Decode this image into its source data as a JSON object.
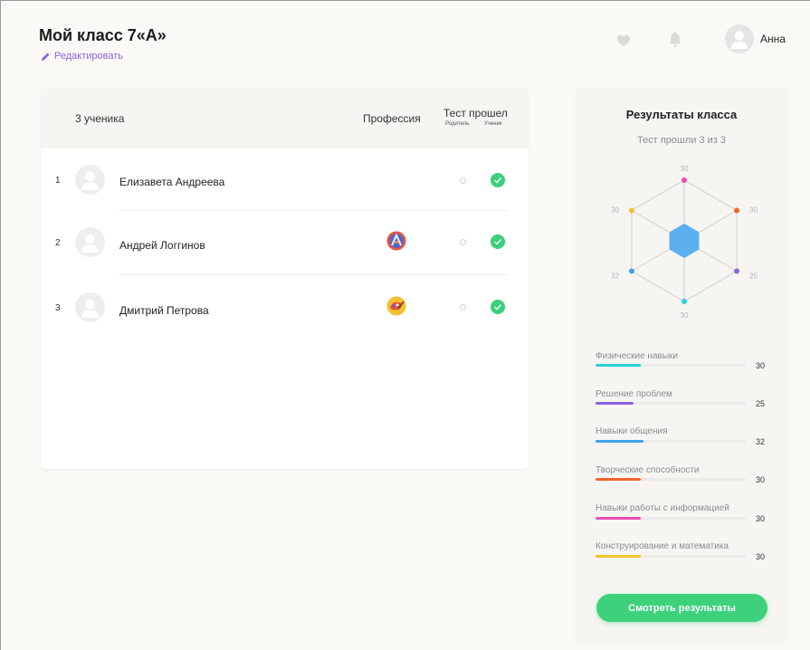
{
  "header": {
    "title": "Мой класс 7«А»",
    "edit_label": "Редактировать",
    "user_name": "Анна"
  },
  "students_table": {
    "count_label": "3 ученика",
    "profession_header": "Профессия",
    "test_header": "Тест прошел",
    "parent_sub": "Родитель",
    "student_sub": "Ученик",
    "rows": [
      {
        "num": "1",
        "name": "Елизавета Андреева",
        "profession": null,
        "parent_passed": false,
        "student_passed": true
      },
      {
        "num": "2",
        "name": "Андрей Логгинов",
        "profession": "architecture-icon",
        "parent_passed": false,
        "student_passed": true
      },
      {
        "num": "3",
        "name": "Дмитрий Петрова",
        "profession": "painting-icon",
        "parent_passed": false,
        "student_passed": true
      }
    ]
  },
  "results": {
    "title": "Результаты класса",
    "subtitle": "Тест прошли 3 из 3",
    "radar_labels": [
      "30",
      "30",
      "25",
      "30",
      "32",
      "30"
    ],
    "radar_colors": [
      "#e84cb6",
      "#f0642e",
      "#8a63e6",
      "#2fd0dc",
      "#3ba4e8",
      "#f2c12e"
    ],
    "skills": [
      {
        "label": "Физические навыки",
        "value": "30",
        "fraction": 0.3,
        "color": "#2fd0dc"
      },
      {
        "label": "Решение проблем",
        "value": "25",
        "fraction": 0.25,
        "color": "#8a63e6"
      },
      {
        "label": "Навыки общения",
        "value": "32",
        "fraction": 0.32,
        "color": "#3ba4e8"
      },
      {
        "label": "Творческие способности",
        "value": "30",
        "fraction": 0.3,
        "color": "#f0642e"
      },
      {
        "label": "Навыки работы с информацией",
        "value": "30",
        "fraction": 0.3,
        "color": "#e84cb6"
      },
      {
        "label": "Конструирование и математика",
        "value": "30",
        "fraction": 0.3,
        "color": "#f2c12e"
      }
    ],
    "button_label": "Смотреть результаты"
  },
  "colors": {
    "accent": "#8a63e6",
    "success": "#3bcf7a",
    "radar_fill": "#4aa8f0"
  }
}
